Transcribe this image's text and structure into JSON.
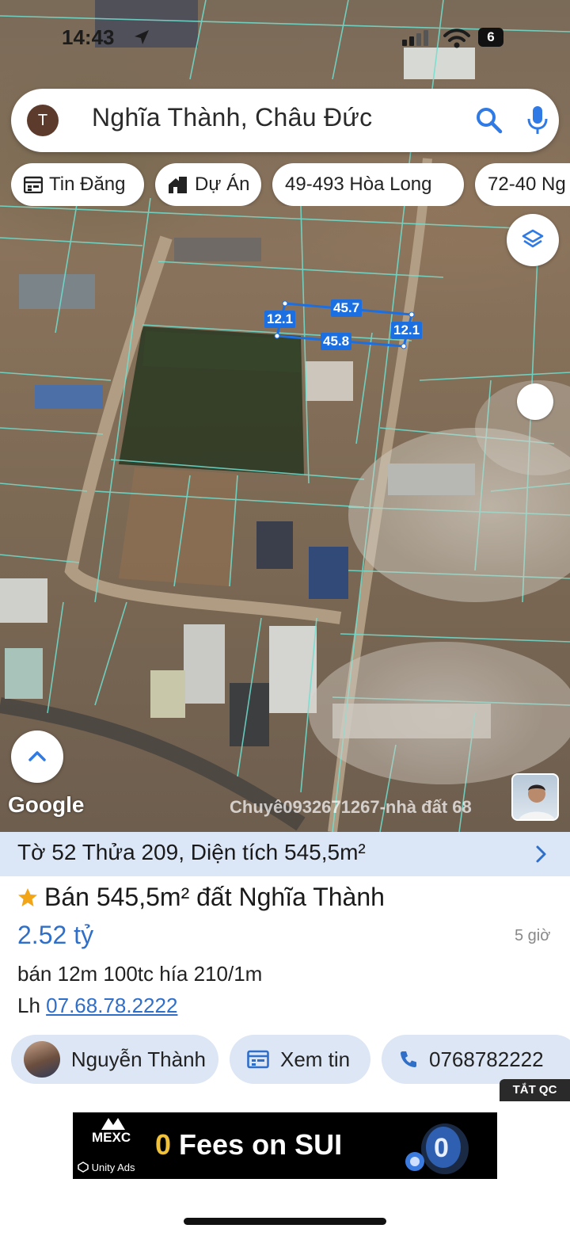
{
  "status_bar": {
    "time": "14:43",
    "battery": "6"
  },
  "search": {
    "avatar_letter": "T",
    "query": "Nghĩa Thành, Châu Đức"
  },
  "chips": [
    {
      "label": "Tin Đăng",
      "icon": "calendar-icon"
    },
    {
      "label": "Dự Án",
      "icon": "building-icon"
    },
    {
      "label": "49-493 Hòa Long",
      "icon": ""
    },
    {
      "label": "72-40 Ng",
      "icon": ""
    }
  ],
  "map": {
    "measurements": {
      "top": "45.7",
      "bottom": "45.8",
      "left": "12.1",
      "right": "12.1"
    },
    "google_logo": "Google",
    "watermark": "Chuyê0932671267-nhà đất 68"
  },
  "parcel_bar": {
    "to_label": "Tờ",
    "to_value": "52",
    "thua_label": "Thửa",
    "thua_value": "209",
    "area_label": "Diện tích",
    "area_value": "545,5m²"
  },
  "listing": {
    "title": "Bán 545,5m² đất Nghĩa Thành",
    "price": "2.52 tỷ",
    "time_ago": "5 giờ",
    "description": "bán 12m 100tc hía 210/1m",
    "contact_prefix": "Lh",
    "contact_phone": "07.68.78.2222"
  },
  "actions": {
    "agent_name": "Nguyễn Thành",
    "view_label": "Xem tin",
    "call_number": "0768782222"
  },
  "ad": {
    "off_label": "TẮT QC",
    "brand": "MEXC",
    "network": "Unity Ads",
    "headline_zero": "0",
    "headline_rest": " Fees on SUI"
  },
  "colors": {
    "accent": "#2f6fc9",
    "info_bar": "#dbe6f6",
    "parcel_lines": "#6fe0d0",
    "measure": "#1c6fe0"
  }
}
